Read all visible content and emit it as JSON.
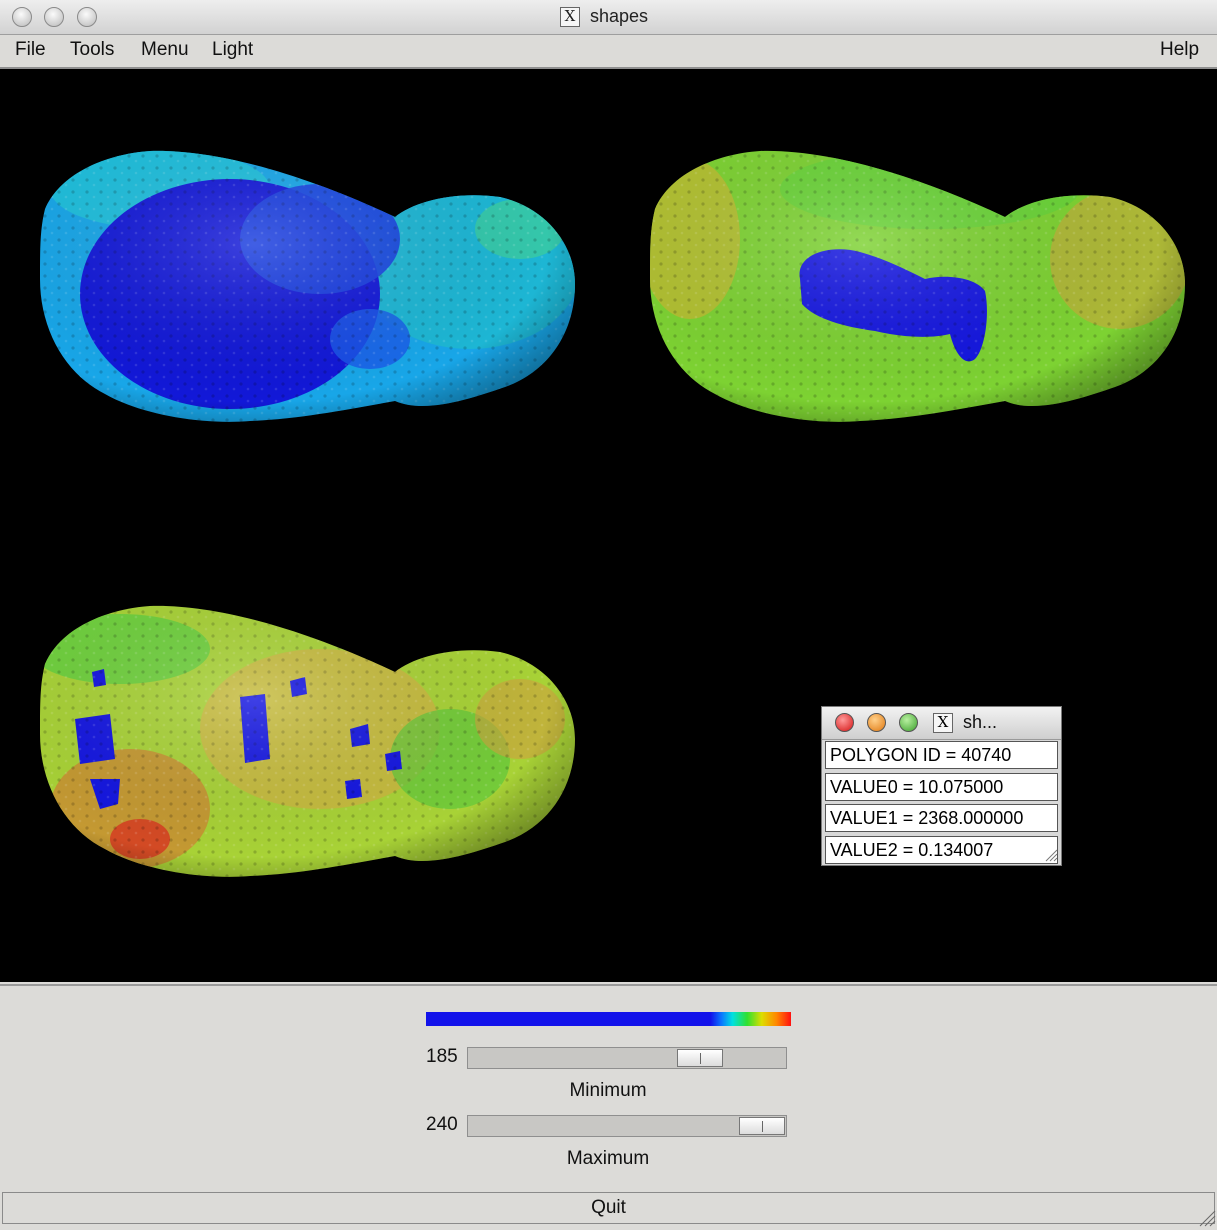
{
  "window": {
    "title": "shapes"
  },
  "menubar": {
    "file": "File",
    "tools": "Tools",
    "menu": "Menu",
    "light": "Light",
    "help": "Help"
  },
  "popup": {
    "caption": "sh...",
    "fields": [
      "POLYGON ID = 40740",
      "VALUE0 = 10.075000",
      "VALUE1 = 2368.000000",
      "VALUE2 = 0.134007"
    ]
  },
  "controls": {
    "minimum": {
      "value": "185",
      "label": "Minimum"
    },
    "maximum": {
      "value": "240",
      "label": "Maximum"
    }
  },
  "quit_label": "Quit",
  "colors": {
    "viewport_bg": "#000000",
    "low": "#1414e6",
    "high": "#ff1010"
  }
}
